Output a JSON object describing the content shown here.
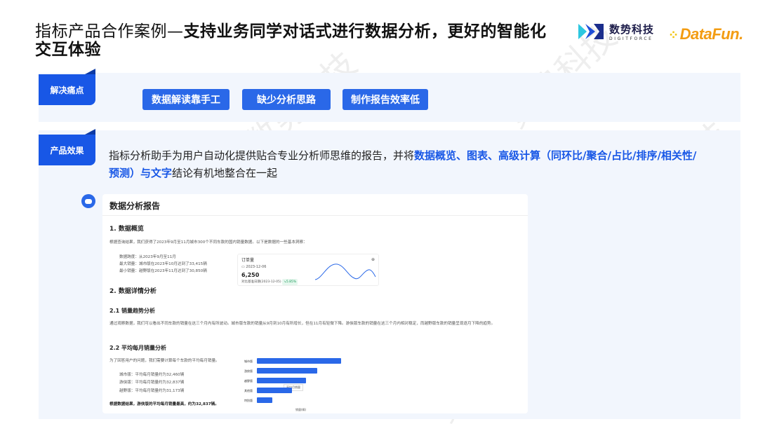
{
  "header": {
    "title_plain": "指标产品合作案例—",
    "title_bold": "支持业务同学对话式进行数据分析，更好的智能化交互体验",
    "logo_cn": "数势科技",
    "logo_en": "DIGITFORCE",
    "logo2": "DataFun."
  },
  "pain": {
    "tag": "解决痛点",
    "items": [
      "数据解读靠手工",
      "缺少分析思路",
      "制作报告效率低"
    ]
  },
  "effect": {
    "tag": "产品效果",
    "desc_1": "指标分析助手为用户自动化提供贴合专业分析师思维的报告，并将",
    "desc_hl": "数据概览、图表、高级计算（同环比/聚合/占比/排序/相关性/预测）与文字",
    "desc_2": "结论有机地整合在一起"
  },
  "report": {
    "title": "数据分析报告",
    "s1": "1. 数据概览",
    "s1_text": "根据查询结果，我们获得了2023年9月至11月城市300个不同车款的国内销量数据。以下是数据的一些基本洞察：",
    "s1_items": [
      "数据跨度：从2023年9月至11月",
      "最大销量：城市版在2023年10月达到了33,415辆",
      "最小销量：越野版在2023年11月达到了30,850辆"
    ],
    "card": {
      "label": "订单量",
      "date": "2023-12-06",
      "value": "6,250",
      "compare": "对比基准日期(2023-12-05)",
      "change": "5.85%"
    },
    "s2": "2. 数据详情分析",
    "s21": "2.1 销量趋势分析",
    "s21_text": "通过观察数据，我们可以看出不同车款的销量在这三个月内有所波动。城市版车款的销量从9月到10月有所增长，但在11月有轻微下降。游侠版车款的销量在这三个月内相对稳定，而越野版车款的销量呈现逐月下降的趋势。",
    "s22": "2.2 平均每月销量分析",
    "s22_text": "为了回答用户的问题，我们需要计算每个车款的平均每月销量。",
    "s22_items": [
      "城市版：平均每月销量约为32,460辆",
      "游侠版：平均每月销量约为32,837辆",
      "越野版：平均每月销量约为31,173辆"
    ],
    "s22_conclusion": "根据数据结果，游侠版的平均每月销量最高，约为32,837辆。",
    "mini_bars": [
      {
        "label": "城市版",
        "value": 1.0
      },
      {
        "label": "游侠版",
        "value": 0.72
      },
      {
        "label": "越野版",
        "value": 0.58
      },
      {
        "label": "其他版",
        "value": 0.42
      },
      {
        "label": "特别版",
        "value": 0.18
      }
    ],
    "tooltip": "平均月销量",
    "axis_label": "销量(辆)"
  },
  "watermark": "数势科技",
  "colors": {
    "accent": "#1857e6",
    "panel": "#f2f6fd"
  }
}
